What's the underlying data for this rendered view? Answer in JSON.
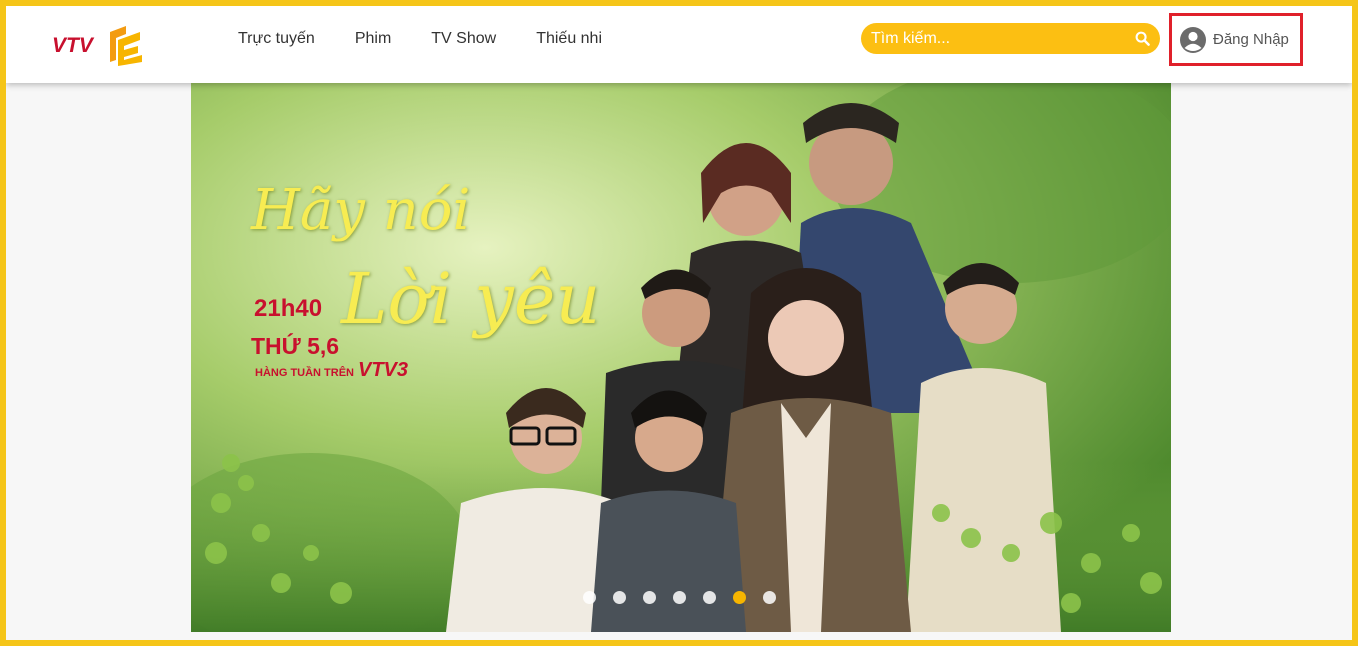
{
  "header": {
    "logo_text": "VTV",
    "nav": [
      {
        "label": "Trực tuyến"
      },
      {
        "label": "Phim"
      },
      {
        "label": "TV Show"
      },
      {
        "label": "Thiếu nhi"
      }
    ],
    "search": {
      "placeholder": "Tìm kiếm...",
      "icon": "search-icon"
    },
    "login": {
      "label": "Đăng Nhập",
      "icon": "user-circle-icon",
      "highlight_color": "#e0202a"
    }
  },
  "banner": {
    "title_line1": "Hãy nói",
    "title_line2": "Lời yêu",
    "airtime": "21h40",
    "days": "THỨ 5,6",
    "schedule": "HÀNG TUẦN TRÊN",
    "channel": "VTV3",
    "dots_count": 7,
    "active_dot_index": 5
  },
  "colors": {
    "frame_border": "#f5c518",
    "search_bg": "#fcbf12",
    "active_dot": "#f7b500"
  }
}
